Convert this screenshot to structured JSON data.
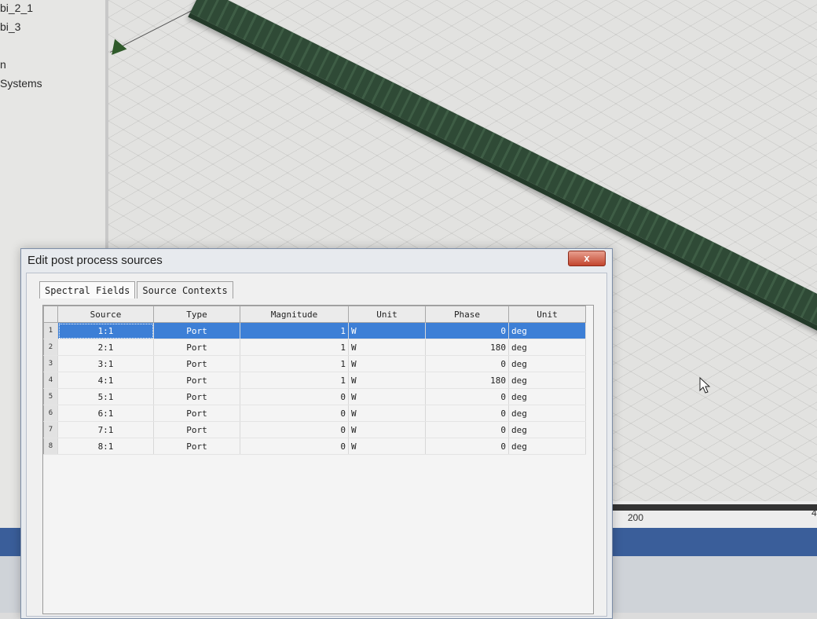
{
  "tree": {
    "items": [
      "bi_2_1",
      "bi_3",
      "n",
      "Systems"
    ]
  },
  "ruler": {
    "tick_1": "200",
    "tick_2": "4"
  },
  "dialog": {
    "title": "Edit post process sources",
    "close_label": "x",
    "tabs": [
      {
        "label": "Spectral Fields",
        "active": true
      },
      {
        "label": "Source Contexts",
        "active": false
      }
    ],
    "columns": [
      "Source",
      "Type",
      "Magnitude",
      "Unit",
      "Phase",
      "Unit"
    ],
    "rows": [
      {
        "n": "1",
        "source": "1:1",
        "type": "Port",
        "magnitude": "1",
        "unit": "W",
        "phase": "0",
        "phase_unit": "deg",
        "selected": true
      },
      {
        "n": "2",
        "source": "2:1",
        "type": "Port",
        "magnitude": "1",
        "unit": "W",
        "phase": "180",
        "phase_unit": "deg"
      },
      {
        "n": "3",
        "source": "3:1",
        "type": "Port",
        "magnitude": "1",
        "unit": "W",
        "phase": "0",
        "phase_unit": "deg"
      },
      {
        "n": "4",
        "source": "4:1",
        "type": "Port",
        "magnitude": "1",
        "unit": "W",
        "phase": "180",
        "phase_unit": "deg"
      },
      {
        "n": "5",
        "source": "5:1",
        "type": "Port",
        "magnitude": "0",
        "unit": "W",
        "phase": "0",
        "phase_unit": "deg"
      },
      {
        "n": "6",
        "source": "6:1",
        "type": "Port",
        "magnitude": "0",
        "unit": "W",
        "phase": "0",
        "phase_unit": "deg"
      },
      {
        "n": "7",
        "source": "7:1",
        "type": "Port",
        "magnitude": "0",
        "unit": "W",
        "phase": "0",
        "phase_unit": "deg"
      },
      {
        "n": "8",
        "source": "8:1",
        "type": "Port",
        "magnitude": "0",
        "unit": "W",
        "phase": "0",
        "phase_unit": "deg"
      }
    ]
  }
}
